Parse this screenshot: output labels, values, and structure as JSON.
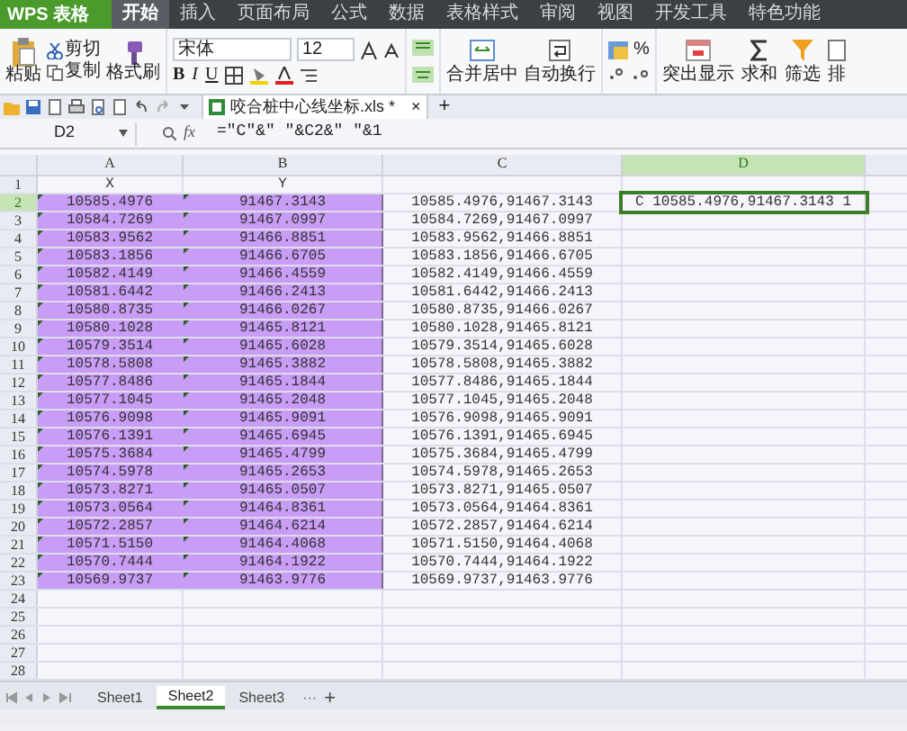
{
  "app_button": "WPS 表格",
  "menu_tabs": [
    {
      "label": "开始",
      "selected": true
    },
    {
      "label": "插入",
      "selected": false
    },
    {
      "label": "页面布局",
      "selected": false
    },
    {
      "label": "公式",
      "selected": false
    },
    {
      "label": "数据",
      "selected": false
    },
    {
      "label": "表格样式",
      "selected": false
    },
    {
      "label": "审阅",
      "selected": false
    },
    {
      "label": "视图",
      "selected": false
    },
    {
      "label": "开发工具",
      "selected": false
    },
    {
      "label": "特色功能",
      "selected": false
    }
  ],
  "ribbon": {
    "paste": "粘贴",
    "cut": "剪切",
    "copy": "复制",
    "format_painter": "格式刷",
    "font_name": "宋体",
    "font_size": "12",
    "bold": "B",
    "italic": "I",
    "underline": "U",
    "merge_center": "合并居中",
    "wrap_text": "自动换行",
    "percent": "%",
    "highlight": "突出显示",
    "sum": "求和",
    "filter": "筛选",
    "sort": "排"
  },
  "document_tab": {
    "title": "咬合桩中心线坐标.xls *",
    "close": "×",
    "add": "+"
  },
  "formula_bar": {
    "name_box": "D2",
    "fx": "fx",
    "formula": "=\"C\"&\" \"&C2&\" \"&1"
  },
  "columns": [
    {
      "label": "A",
      "selected": false
    },
    {
      "label": "B",
      "selected": false
    },
    {
      "label": "C",
      "selected": false
    },
    {
      "label": "D",
      "selected": true
    }
  ],
  "rows": [
    {
      "number": "1",
      "selected": false,
      "shaded": false,
      "text_flag": false,
      "cells": {
        "a": "X",
        "b": "Y"
      }
    },
    {
      "number": "2",
      "selected": true,
      "shaded": true,
      "text_flag": true,
      "cells": {
        "a": "10585.4976",
        "b": "91467.3143",
        "c": "10585.4976,91467.3143",
        "d": "C 10585.4976,91467.3143 1"
      }
    },
    {
      "number": "3",
      "selected": false,
      "shaded": true,
      "text_flag": true,
      "cells": {
        "a": "10584.7269",
        "b": "91467.0997",
        "c": "10584.7269,91467.0997"
      }
    },
    {
      "number": "4",
      "selected": false,
      "shaded": true,
      "text_flag": true,
      "cells": {
        "a": "10583.9562",
        "b": "91466.8851",
        "c": "10583.9562,91466.8851"
      }
    },
    {
      "number": "5",
      "selected": false,
      "shaded": true,
      "text_flag": true,
      "cells": {
        "a": "10583.1856",
        "b": "91466.6705",
        "c": "10583.1856,91466.6705"
      }
    },
    {
      "number": "6",
      "selected": false,
      "shaded": true,
      "text_flag": true,
      "cells": {
        "a": "10582.4149",
        "b": "91466.4559",
        "c": "10582.4149,91466.4559"
      }
    },
    {
      "number": "7",
      "selected": false,
      "shaded": true,
      "text_flag": true,
      "cells": {
        "a": "10581.6442",
        "b": "91466.2413",
        "c": "10581.6442,91466.2413"
      }
    },
    {
      "number": "8",
      "selected": false,
      "shaded": true,
      "text_flag": true,
      "cells": {
        "a": "10580.8735",
        "b": "91466.0267",
        "c": "10580.8735,91466.0267"
      }
    },
    {
      "number": "9",
      "selected": false,
      "shaded": true,
      "text_flag": true,
      "cells": {
        "a": "10580.1028",
        "b": "91465.8121",
        "c": "10580.1028,91465.8121"
      }
    },
    {
      "number": "10",
      "selected": false,
      "shaded": true,
      "text_flag": true,
      "cells": {
        "a": "10579.3514",
        "b": "91465.6028",
        "c": "10579.3514,91465.6028"
      }
    },
    {
      "number": "11",
      "selected": false,
      "shaded": true,
      "text_flag": true,
      "cells": {
        "a": "10578.5808",
        "b": "91465.3882",
        "c": "10578.5808,91465.3882"
      }
    },
    {
      "number": "12",
      "selected": false,
      "shaded": true,
      "text_flag": true,
      "cells": {
        "a": "10577.8486",
        "b": "91465.1844",
        "c": "10577.8486,91465.1844"
      }
    },
    {
      "number": "13",
      "selected": false,
      "shaded": true,
      "text_flag": true,
      "cells": {
        "a": "10577.1045",
        "b": "91465.2048",
        "c": "10577.1045,91465.2048"
      }
    },
    {
      "number": "14",
      "selected": false,
      "shaded": true,
      "text_flag": true,
      "cells": {
        "a": "10576.9098",
        "b": "91465.9091",
        "c": "10576.9098,91465.9091"
      }
    },
    {
      "number": "15",
      "selected": false,
      "shaded": true,
      "text_flag": true,
      "cells": {
        "a": "10576.1391",
        "b": "91465.6945",
        "c": "10576.1391,91465.6945"
      }
    },
    {
      "number": "16",
      "selected": false,
      "shaded": true,
      "text_flag": true,
      "cells": {
        "a": "10575.3684",
        "b": "91465.4799",
        "c": "10575.3684,91465.4799"
      }
    },
    {
      "number": "17",
      "selected": false,
      "shaded": true,
      "text_flag": true,
      "cells": {
        "a": "10574.5978",
        "b": "91465.2653",
        "c": "10574.5978,91465.2653"
      }
    },
    {
      "number": "18",
      "selected": false,
      "shaded": true,
      "text_flag": true,
      "cells": {
        "a": "10573.8271",
        "b": "91465.0507",
        "c": "10573.8271,91465.0507"
      }
    },
    {
      "number": "19",
      "selected": false,
      "shaded": true,
      "text_flag": true,
      "cells": {
        "a": "10573.0564",
        "b": "91464.8361",
        "c": "10573.0564,91464.8361"
      }
    },
    {
      "number": "20",
      "selected": false,
      "shaded": true,
      "text_flag": true,
      "cells": {
        "a": "10572.2857",
        "b": "91464.6214",
        "c": "10572.2857,91464.6214"
      }
    },
    {
      "number": "21",
      "selected": false,
      "shaded": true,
      "text_flag": true,
      "cells": {
        "a": "10571.5150",
        "b": "91464.4068",
        "c": "10571.5150,91464.4068"
      }
    },
    {
      "number": "22",
      "selected": false,
      "shaded": true,
      "text_flag": true,
      "cells": {
        "a": "10570.7444",
        "b": "91464.1922",
        "c": "10570.7444,91464.1922"
      }
    },
    {
      "number": "23",
      "selected": false,
      "shaded": true,
      "text_flag": true,
      "cells": {
        "a": "10569.9737",
        "b": "91463.9776",
        "c": "10569.9737,91463.9776"
      }
    },
    {
      "number": "24",
      "selected": false,
      "shaded": false,
      "text_flag": false,
      "cells": {}
    },
    {
      "number": "25",
      "selected": false,
      "shaded": false,
      "text_flag": false,
      "cells": {}
    },
    {
      "number": "26",
      "selected": false,
      "shaded": false,
      "text_flag": false,
      "cells": {}
    },
    {
      "number": "27",
      "selected": false,
      "shaded": false,
      "text_flag": false,
      "cells": {}
    },
    {
      "number": "28",
      "selected": false,
      "shaded": false,
      "text_flag": false,
      "cells": {}
    }
  ],
  "sheet_tabs": [
    {
      "label": "Sheet1",
      "selected": false
    },
    {
      "label": "Sheet2",
      "selected": true
    },
    {
      "label": "Sheet3",
      "selected": false
    }
  ],
  "sheet_more": "···",
  "sheet_add": "+"
}
